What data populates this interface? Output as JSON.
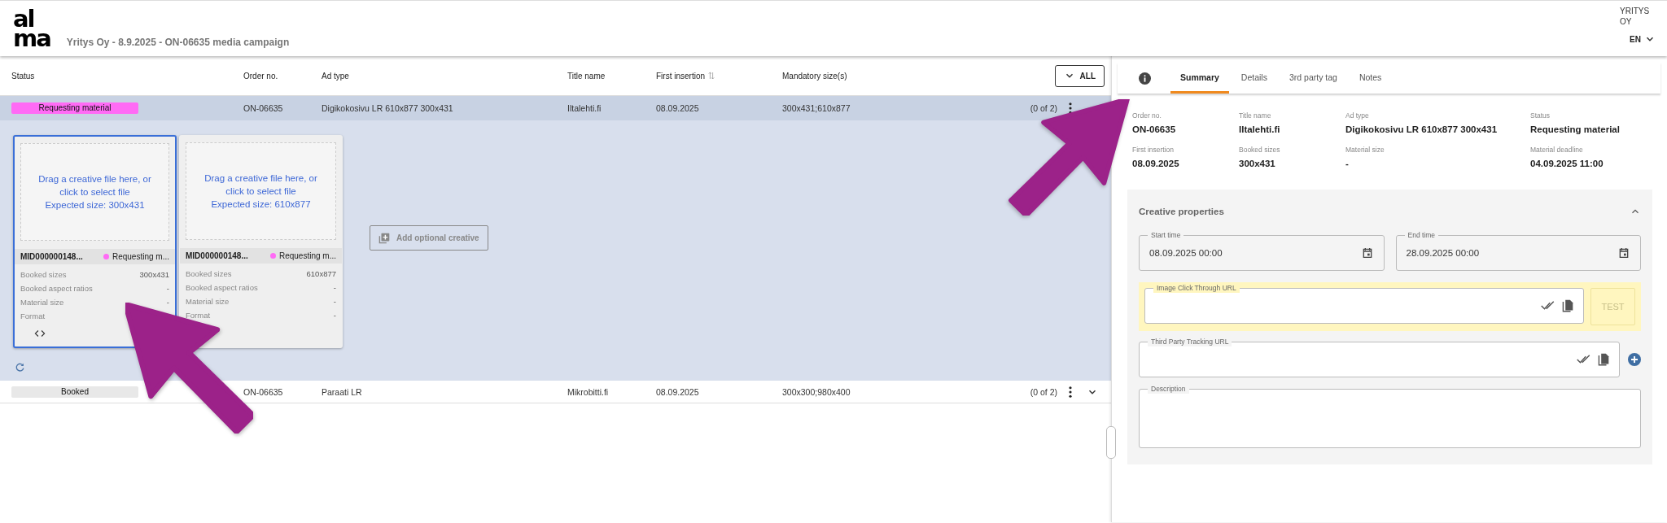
{
  "header": {
    "logo": [
      "al",
      "ma"
    ],
    "title": "Yritys Oy - 8.9.2025 - ON-06635 media campaign",
    "company": "YRITYS OY",
    "language": "EN"
  },
  "table": {
    "columns": [
      {
        "label": "Status",
        "sortable": false
      },
      {
        "label": "Order no.",
        "sortable": false
      },
      {
        "label": "Ad type",
        "sortable": false
      },
      {
        "label": "Title name",
        "sortable": false
      },
      {
        "label": "First insertion",
        "sortable": true
      },
      {
        "label": "Mandatory size(s)",
        "sortable": false
      }
    ],
    "filter_button": "ALL",
    "rows": [
      {
        "status": "Requesting material",
        "color": "#ff6bf5",
        "order_no": "ON-06635",
        "ad_type": "Digikokosivu LR 610x877 300x431",
        "title_name": "Iltalehti.fi",
        "first_insertion": "08.09.2025",
        "mandatory_sizes": "300x431;610x877",
        "count": "(0 of 2)",
        "expanded": true,
        "creatives": [
          {
            "hint": "Drag a creative file here, or click to select file",
            "expected": "Expected size: 300x431",
            "id": "MID000000148...",
            "status": "Requesting m...",
            "color": "#ff6bf5",
            "selected": true,
            "nav": true,
            "properties": [
              {
                "label": "Booked sizes",
                "value": "300x431"
              },
              {
                "label": "Booked aspect ratios",
                "value": "-"
              },
              {
                "label": "Material size",
                "value": "-"
              },
              {
                "label": "Format"
              }
            ]
          },
          {
            "hint": "Drag a creative file here, or click to select file",
            "expected": "Expected size: 610x877",
            "id": "MID000000148...",
            "status": "Requesting m...",
            "color": "#ff6bf5",
            "selected": false,
            "nav": false,
            "properties": [
              {
                "label": "Booked sizes",
                "value": "610x877"
              },
              {
                "label": "Booked aspect ratios",
                "value": "-"
              },
              {
                "label": "Material size",
                "value": "-"
              },
              {
                "label": "Format",
                "value": "-"
              }
            ]
          }
        ],
        "add_button": "Add optional creative"
      },
      {
        "status": "Booked",
        "color": "#e8e8e8",
        "order_no": "ON-06635",
        "ad_type": "Paraati LR",
        "title_name": "Mikrobitti.fi",
        "first_insertion": "08.09.2025",
        "mandatory_sizes": "300x300;980x400",
        "count": "(0 of 2)",
        "expanded": false
      }
    ]
  },
  "detail": {
    "tabs": [
      {
        "label": "Summary",
        "selected": true
      },
      {
        "label": "Details",
        "selected": false
      },
      {
        "label": "3rd party tag",
        "selected": false
      },
      {
        "label": "Notes",
        "selected": false
      }
    ],
    "summary": [
      {
        "label": "Order no.",
        "value": "ON-06635"
      },
      {
        "label": "Title name",
        "value": "Iltalehti.fi"
      },
      {
        "label": "Ad type",
        "value": "Digikokosivu LR 610x877 300x431"
      },
      {
        "label": "Status",
        "value": "Requesting material"
      },
      {
        "label": "First insertion",
        "value": "08.09.2025"
      },
      {
        "label": "Booked sizes",
        "value": "300x431"
      },
      {
        "label": "Material size",
        "value": "-"
      },
      {
        "label": "Material deadline",
        "value": "04.09.2025 11:00"
      }
    ],
    "section": {
      "title": "Creative properties",
      "expanded": true,
      "fields": [
        {
          "kind": "date",
          "label": "Start time",
          "value": "08.09.2025 00:00"
        },
        {
          "kind": "date",
          "label": "End time",
          "value": "28.09.2025 00:00"
        },
        {
          "kind": "url",
          "label": "Image Click Through URL",
          "highlighted": true,
          "action": "TEST",
          "addable": false
        },
        {
          "kind": "url",
          "label": "Third Party Tracking URL",
          "highlighted": false,
          "addable": true
        },
        {
          "kind": "textarea",
          "label": "Description"
        }
      ]
    }
  },
  "annotations": [
    {
      "kind": "arrow",
      "flipped": false
    },
    {
      "kind": "arrow",
      "flipped": true
    }
  ]
}
